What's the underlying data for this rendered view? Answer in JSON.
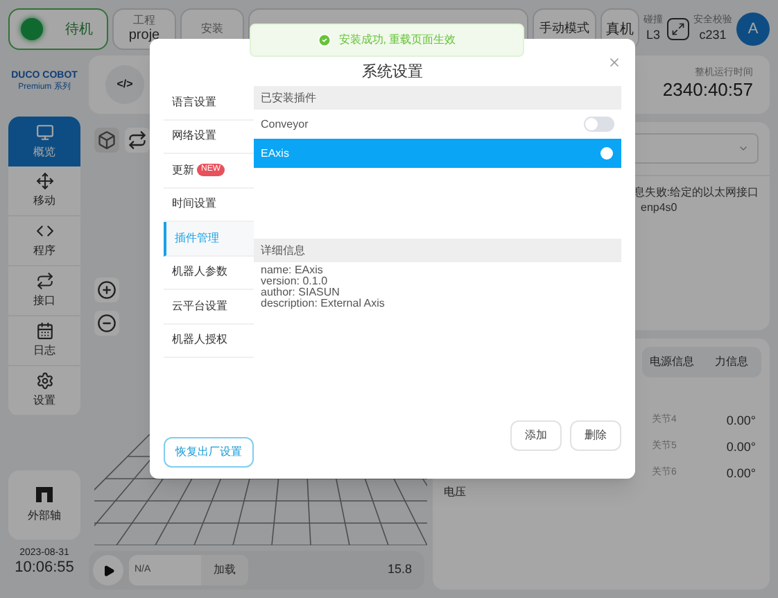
{
  "status_bar": {
    "state": "待机",
    "items": [
      {
        "label": "工程",
        "value": "proje"
      },
      {
        "label": "安装"
      }
    ],
    "mode": "手动模式",
    "machine": "真机",
    "collision": {
      "label": "碰撞",
      "value": "L3"
    },
    "safety": {
      "label": "安全校验",
      "value": "c231"
    },
    "avatar": "A"
  },
  "sidebar": {
    "logo": "DUCO COBOT",
    "series": "Premium 系列",
    "items": [
      {
        "label": "概览",
        "selected": true
      },
      {
        "label": "移动",
        "selected": false
      },
      {
        "label": "程序",
        "selected": false
      },
      {
        "label": "接口",
        "selected": false
      },
      {
        "label": "日志",
        "selected": false
      },
      {
        "label": "设置",
        "selected": false
      }
    ],
    "external": "外部轴",
    "date": "2023-08-31",
    "time": "10:06:55"
  },
  "toolbar": {
    "code": "</>",
    "runtime_label": "整机运行时间",
    "runtime": "2340:40:57"
  },
  "log": {
    "message": "息失败:给定的以太网接口",
    "detail": "enp4s0"
  },
  "info_panel": {
    "tabs": [
      {
        "label": "电源信息",
        "selected": false
      },
      {
        "label": "力信息",
        "selected": false
      }
    ],
    "joints": [
      {
        "name": "关节4",
        "value": "0.00°"
      },
      {
        "name": "关节5",
        "value": "0.00°"
      },
      {
        "name": "关节6",
        "value": "0.00°"
      }
    ],
    "voltage_label": "电压"
  },
  "player": {
    "program": "N/A",
    "load": "加载",
    "speed": "15.8"
  },
  "dialog": {
    "title": "系统设置",
    "menu": [
      {
        "label": "语言设置",
        "selected": false
      },
      {
        "label": "网络设置",
        "selected": false
      },
      {
        "label": "更新",
        "badge": "NEW",
        "selected": false
      },
      {
        "label": "时间设置",
        "selected": false
      },
      {
        "label": "插件管理",
        "selected": true
      },
      {
        "label": "机器人参数",
        "selected": false
      },
      {
        "label": "云平台设置",
        "selected": false
      },
      {
        "label": "机器人授权",
        "selected": false
      }
    ],
    "reset": "恢复出厂设置",
    "plugins_header": "已安装插件",
    "plugins": [
      {
        "name": "Conveyor",
        "on": false,
        "selected": false
      },
      {
        "name": "EAxis",
        "on": true,
        "selected": true
      }
    ],
    "details_header": "详细信息",
    "details": [
      "name: EAxis",
      "version: 0.1.0",
      "author: SIASUN",
      "description: External Axis"
    ],
    "buttons": [
      "添加",
      "删除"
    ]
  },
  "toast": {
    "message": "安装成功, 重载页面生效"
  }
}
